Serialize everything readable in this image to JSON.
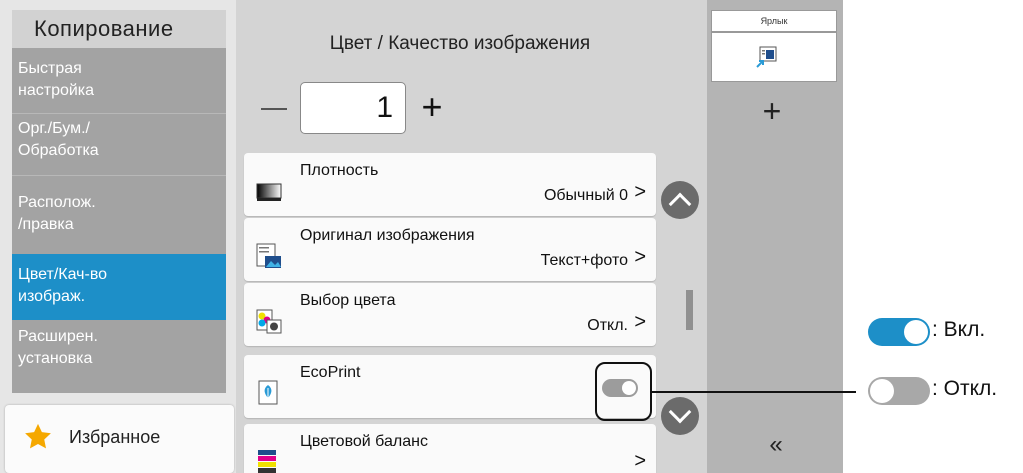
{
  "sidebar": {
    "title": "Копирование",
    "items": [
      {
        "line1": "Быстрая",
        "line2": "настройка"
      },
      {
        "line1": "Орг./Бум./",
        "line2": "Обработка"
      },
      {
        "line1": "Располож.",
        "line2": "/правка"
      },
      {
        "line1": "Цвет/Кач-во",
        "line2": "изображ.",
        "active": true
      },
      {
        "line1": "Расширен.",
        "line2": "установка"
      }
    ],
    "favorites_label": "Избранное"
  },
  "main": {
    "title": "Цвет / Качество изображения",
    "copies": "1",
    "minus_label": "—",
    "plus_label": "+",
    "rows": [
      {
        "name": "Плотность",
        "value": "Обычный 0",
        "icon": "density-icon"
      },
      {
        "name": "Оригинал изображения",
        "value": "Текст+фото",
        "icon": "original-image-icon"
      },
      {
        "name": "Выбор цвета",
        "value": "Откл.",
        "icon": "color-selection-icon"
      },
      {
        "name": "EcoPrint",
        "value": "",
        "icon": "ecoprint-icon",
        "toggle": "off"
      },
      {
        "name": "Цветовой баланс",
        "value": "",
        "icon": "color-balance-icon"
      }
    ],
    "chevron": ">"
  },
  "right_panel": {
    "shortcut_tab_label": "Ярлык",
    "add_label": "+",
    "collapse_label": "«"
  },
  "legend": {
    "on_label": ": Вкл.",
    "off_label": ": Откл."
  },
  "colors": {
    "accent": "#1d8fc8",
    "toggle_off": "#9c9c9c",
    "sidebar_bg": "#a3a3a3"
  }
}
